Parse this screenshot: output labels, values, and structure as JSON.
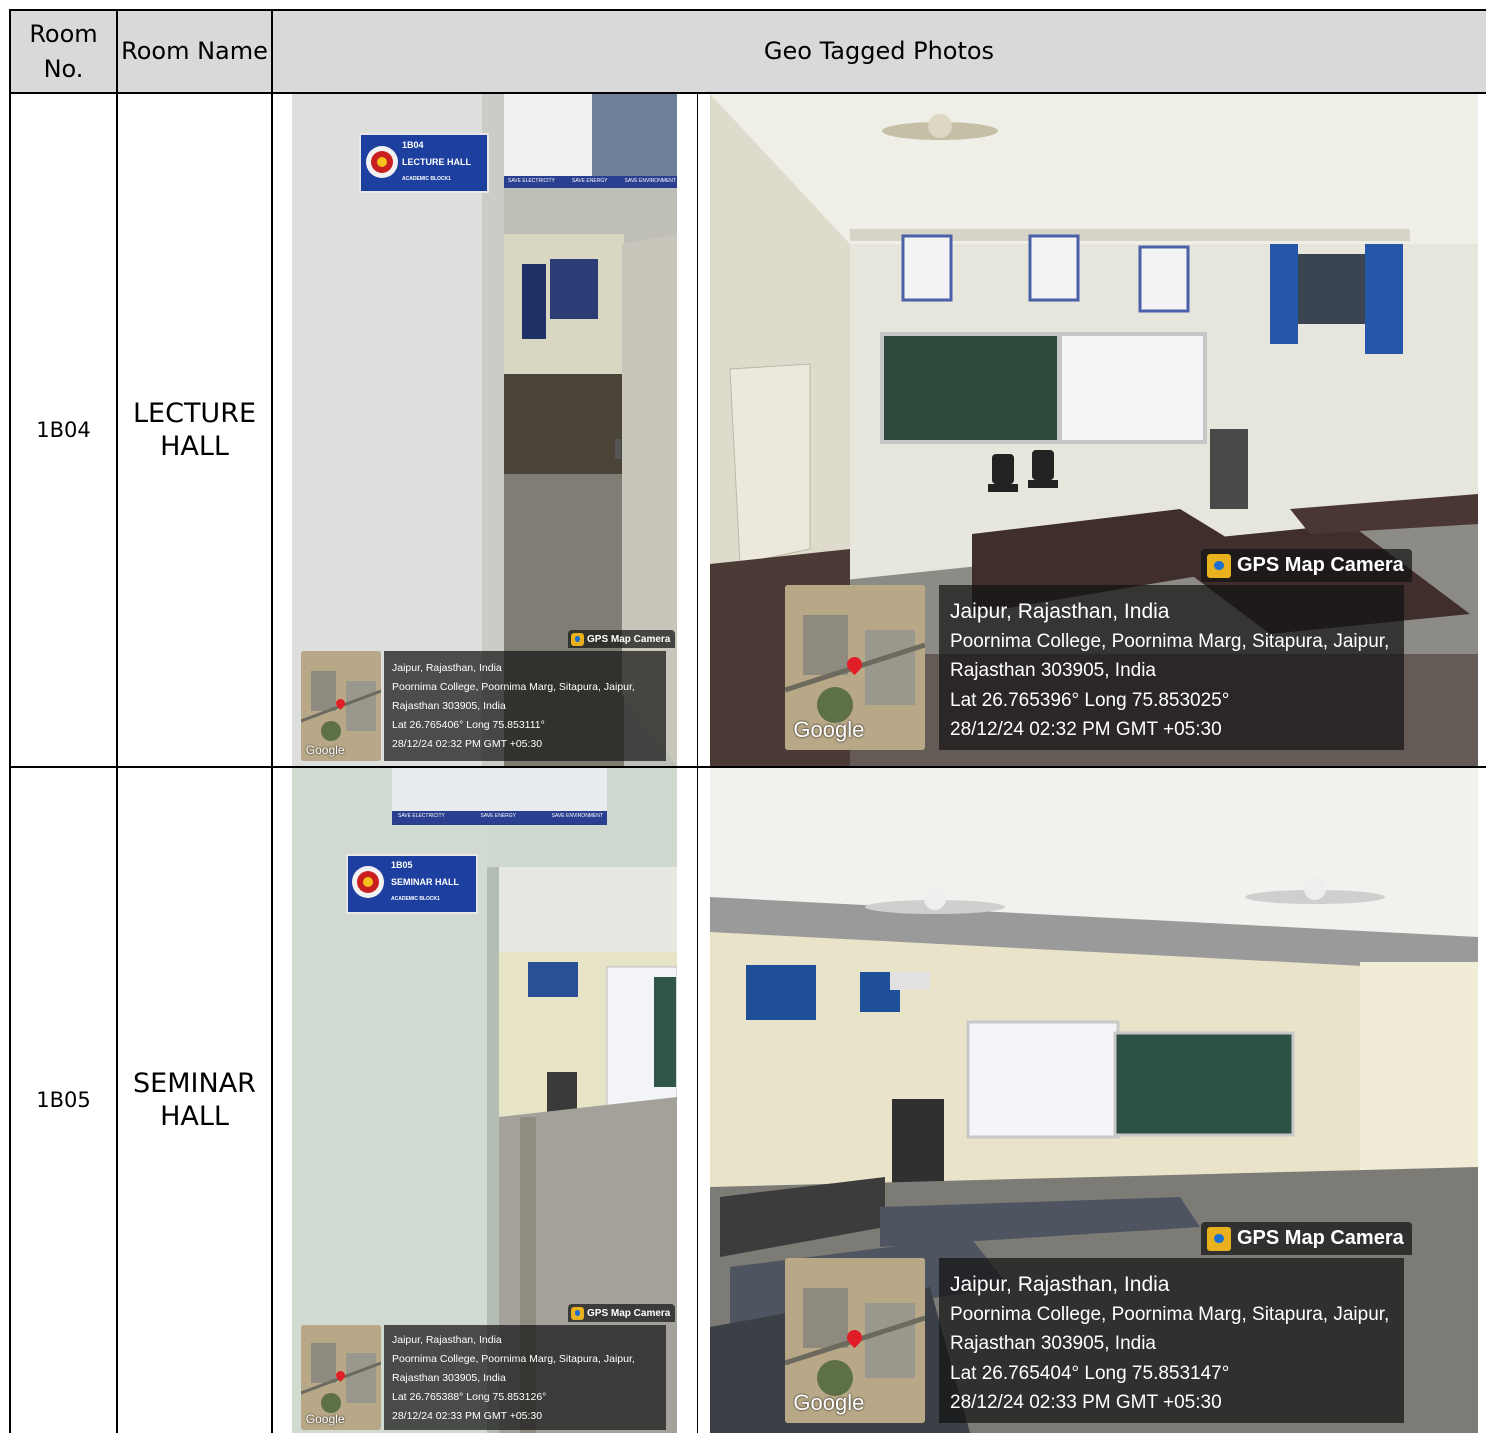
{
  "header": {
    "room_no": "Room No.",
    "room_name": "Room Name",
    "photos": "Geo Tagged Photos"
  },
  "rows": [
    {
      "no": "1B04",
      "name": "LECTURE HALL",
      "photos": [
        {
          "sign_number": "1B04",
          "sign_name": "LECTURE HALL",
          "sign_sub": "ACADEMIC BLOCK1",
          "poster_footer": [
            "SAVE ELECTRICITY",
            "SAVE ENERGY",
            "SAVE ENVIRONMENT"
          ],
          "gps": {
            "brand": "GPS Map Camera",
            "place": "Jaipur, Rajasthan, India",
            "address1": "Poornima College, Poornima Marg, Sitapura, Jaipur,",
            "address2": "Rajasthan 303905, India",
            "coords": "Lat 26.765406° Long 75.853111°",
            "time": "28/12/24 02:32 PM GMT +05:30",
            "map_label": "Google"
          }
        },
        {
          "gps": {
            "brand": "GPS Map Camera",
            "place": "Jaipur, Rajasthan, India",
            "address1": "Poornima College, Poornima Marg, Sitapura, Jaipur,",
            "address2": "Rajasthan 303905, India",
            "coords": "Lat 26.765396° Long 75.853025°",
            "time": "28/12/24 02:32 PM GMT +05:30",
            "map_label": "Google"
          }
        }
      ]
    },
    {
      "no": "1B05",
      "name": "SEMINAR HALL",
      "photos": [
        {
          "sign_number": "1B05",
          "sign_name": "SEMINAR HALL",
          "sign_sub": "ACADEMIC BLOCK1",
          "poster_footer": [
            "SAVE ELECTRICITY",
            "SAVE ENERGY",
            "SAVE ENVIRONMENT"
          ],
          "gps": {
            "brand": "GPS Map Camera",
            "place": "Jaipur, Rajasthan, India",
            "address1": "Poornima College, Poornima Marg, Sitapura, Jaipur,",
            "address2": "Rajasthan 303905, India",
            "coords": "Lat 26.765388° Long 75.853126°",
            "time": "28/12/24 02:33 PM GMT +05:30",
            "map_label": "Google"
          }
        },
        {
          "gps": {
            "brand": "GPS Map Camera",
            "place": "Jaipur, Rajasthan, India",
            "address1": "Poornima College, Poornima Marg, Sitapura, Jaipur,",
            "address2": "Rajasthan 303905, India",
            "coords": "Lat 26.765404° Long 75.853147°",
            "time": "28/12/24 02:33 PM GMT +05:30",
            "map_label": "Google"
          }
        }
      ]
    }
  ]
}
